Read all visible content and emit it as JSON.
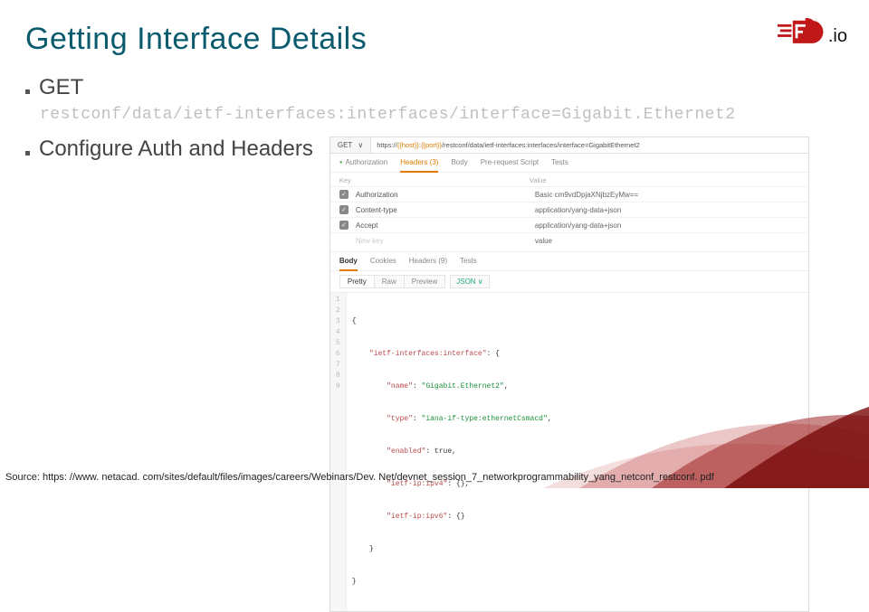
{
  "title": "Getting Interface Details",
  "logo_text": ".io",
  "bullets": {
    "get": "GET",
    "url": "restconf/data/ietf-interfaces:interfaces/interface=Gigabit.Ethernet2",
    "auth": "Configure Auth and Headers"
  },
  "postman": {
    "method": "GET",
    "chevron": "∨",
    "url_prefix": "https://",
    "url_host": "{{host}}",
    "url_sep": ":",
    "url_port": "{{port}}",
    "url_path": "/restconf/data/ietf-interfaces:interfaces/interface=GigabitEthernet2",
    "tabs": {
      "auth": "Authorization",
      "headers": "Headers (3)",
      "body": "Body",
      "prereq": "Pre-request Script",
      "tests": "Tests"
    },
    "hdr": {
      "key": "Key",
      "value": "Value"
    },
    "rows": [
      {
        "key": "Authorization",
        "value": "Basic cm9vdDpjaXNjbzEyMw=="
      },
      {
        "key": "Content-type",
        "value": "application/yang-data+json"
      },
      {
        "key": "Accept",
        "value": "application/yang-data+json"
      }
    ],
    "newrow": {
      "key": "New key",
      "value": "value"
    },
    "tabs2": {
      "body": "Body",
      "cookies": "Cookies",
      "headers": "Headers (9)",
      "tests": "Tests"
    },
    "sub": {
      "pretty": "Pretty",
      "raw": "Raw",
      "preview": "Preview",
      "json": "JSON ∨"
    },
    "code": {
      "l1": "{",
      "l2a": "    ",
      "l2k": "\"ietf-interfaces:interface\"",
      "l2b": ": {",
      "l3a": "        ",
      "l3k": "\"name\"",
      "l3b": ": ",
      "l3v": "\"Gigabit.Ethernet2\"",
      "l3c": ",",
      "l4a": "        ",
      "l4k": "\"type\"",
      "l4b": ": ",
      "l4v": "\"iana-if-type:ethernetCsmacd\"",
      "l4c": ",",
      "l5a": "        ",
      "l5k": "\"enabled\"",
      "l5b": ": ",
      "l5v": "true",
      "l5c": ",",
      "l6a": "        ",
      "l6k": "\"ietf-ip:ipv4\"",
      "l6b": ": {},",
      "l7a": "        ",
      "l7k": "\"ietf-ip:ipv6\"",
      "l7b": ": {}",
      "l8": "    }",
      "l9": "}"
    },
    "lines": [
      "1",
      "2",
      "3",
      "4",
      "5",
      "6",
      "7",
      "8",
      "9"
    ]
  },
  "source": "Source: https: //www. netacad. com/sites/default/files/images/careers/Webinars/Dev. Net/devnet_session_7_networkprogrammability_yang_netconf_restconf. pdf"
}
